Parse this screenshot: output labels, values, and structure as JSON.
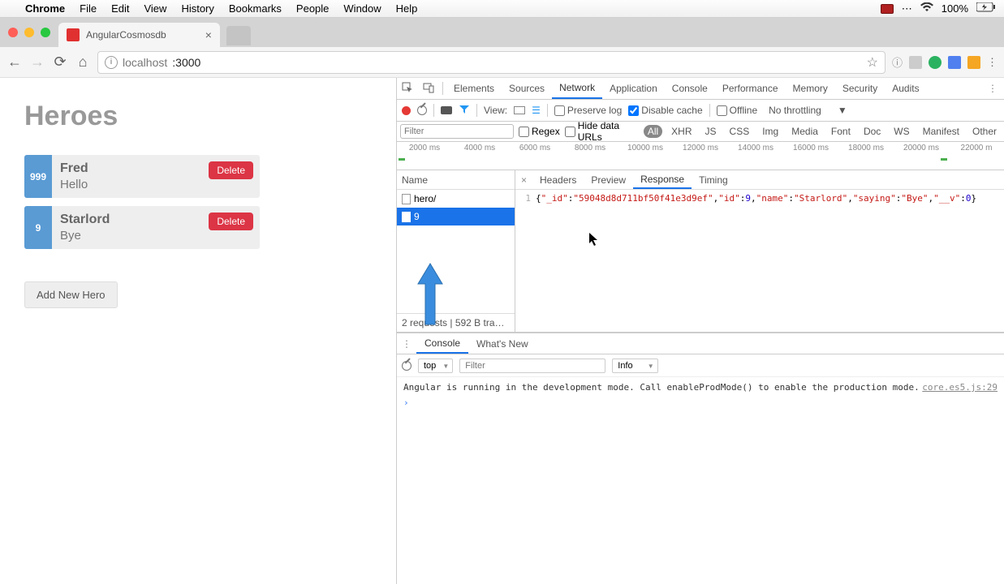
{
  "mac_menu": {
    "app": "Chrome",
    "items": [
      "File",
      "Edit",
      "View",
      "History",
      "Bookmarks",
      "People",
      "Window",
      "Help"
    ],
    "battery": "100%"
  },
  "browser": {
    "tab_title": "AngularCosmosdb",
    "url_host": "localhost",
    "url_port": ":3000"
  },
  "page": {
    "title": "Heroes",
    "heroes": [
      {
        "id": "999",
        "name": "Fred",
        "saying": "Hello"
      },
      {
        "id": "9",
        "name": "Starlord",
        "saying": "Bye"
      }
    ],
    "delete_label": "Delete",
    "add_label": "Add New Hero"
  },
  "devtools": {
    "panels": [
      "Elements",
      "Sources",
      "Network",
      "Application",
      "Console",
      "Performance",
      "Memory",
      "Security",
      "Audits"
    ],
    "active_panel": "Network",
    "toolbar": {
      "view_label": "View:",
      "preserve_log": "Preserve log",
      "disable_cache": "Disable cache",
      "offline": "Offline",
      "throttling": "No throttling"
    },
    "filter": {
      "placeholder": "Filter",
      "regex": "Regex",
      "hide_data": "Hide data URLs",
      "types": [
        "All",
        "XHR",
        "JS",
        "CSS",
        "Img",
        "Media",
        "Font",
        "Doc",
        "WS",
        "Manifest",
        "Other"
      ],
      "active_type": "All"
    },
    "timeline_ticks": [
      "2000 ms",
      "4000 ms",
      "6000 ms",
      "8000 ms",
      "10000 ms",
      "12000 ms",
      "14000 ms",
      "16000 ms",
      "18000 ms",
      "20000 ms",
      "22000 m"
    ],
    "requests": {
      "header": "Name",
      "items": [
        "hero/",
        "9"
      ],
      "selected": "9",
      "status": "2 requests | 592 B tran…"
    },
    "response": {
      "tabs": [
        "Headers",
        "Preview",
        "Response",
        "Timing"
      ],
      "active": "Response",
      "json": {
        "_id": "59048d8d711bf50f41e3d9ef",
        "id": 9,
        "name": "Starlord",
        "saying": "Bye",
        "__v": 0
      }
    },
    "drawer": {
      "tabs": [
        "Console",
        "What's New"
      ],
      "active": "Console",
      "context": "top",
      "filter_placeholder": "Filter",
      "level": "Info",
      "message": "Angular is running in the development mode. Call enableProdMode() to enable the production mode.",
      "source": "core.es5.js:29"
    }
  }
}
